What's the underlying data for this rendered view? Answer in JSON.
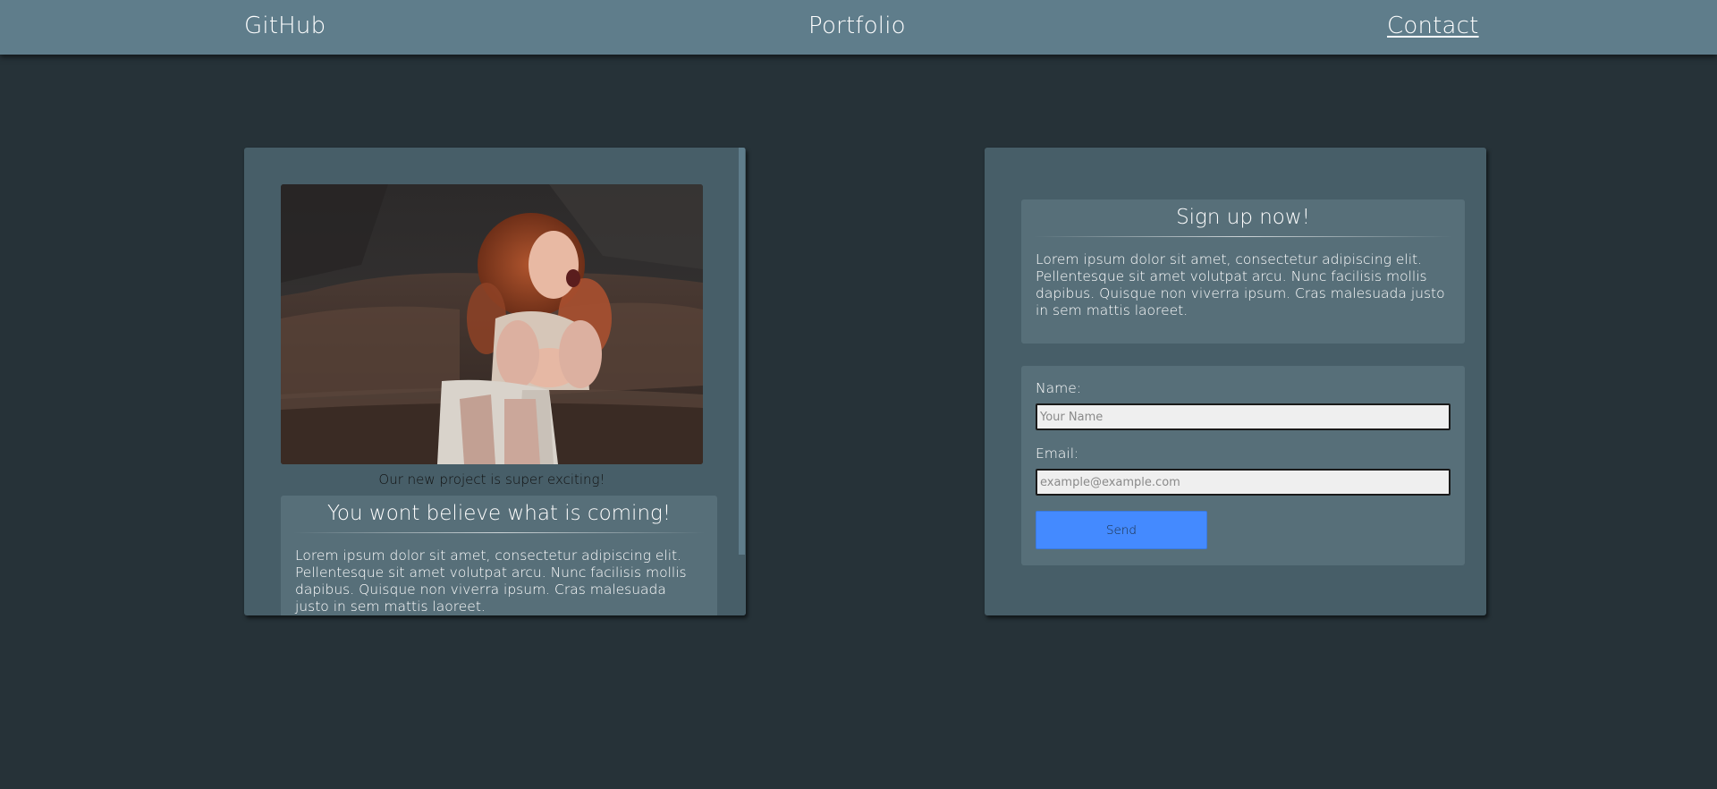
{
  "nav": {
    "github": "GitHub",
    "portfolio": "Portfolio",
    "contact": "Contact"
  },
  "project_card": {
    "image_alt": "Woman laughing on a leather sofa",
    "caption": "Our new project is super exciting!",
    "title": "You wont believe what is coming!",
    "body": "Lorem ipsum dolor sit amet, consectetur adipiscing elit. Pellentesque sit amet volutpat arcu. Nunc facilisis mollis dapibus. Quisque non viverra ipsum. Cras malesuada justo in sem mattis laoreet."
  },
  "signup_card": {
    "title": "Sign up now!",
    "body": "Lorem ipsum dolor sit amet, consectetur adipiscing elit. Pellentesque sit amet volutpat arcu. Nunc facilisis mollis dapibus. Quisque non viverra ipsum. Cras malesuada justo in sem mattis laoreet.",
    "form": {
      "name_label": "Name:",
      "name_placeholder": "Your Name",
      "name_value": "",
      "email_label": "Email:",
      "email_placeholder": "example@example.com",
      "email_value": "",
      "send_label": "Send"
    }
  },
  "colors": {
    "background": "#263238",
    "nav": "#5f7d8b",
    "card": "#475e68",
    "panel": "#576f79",
    "button": "#448aff"
  }
}
